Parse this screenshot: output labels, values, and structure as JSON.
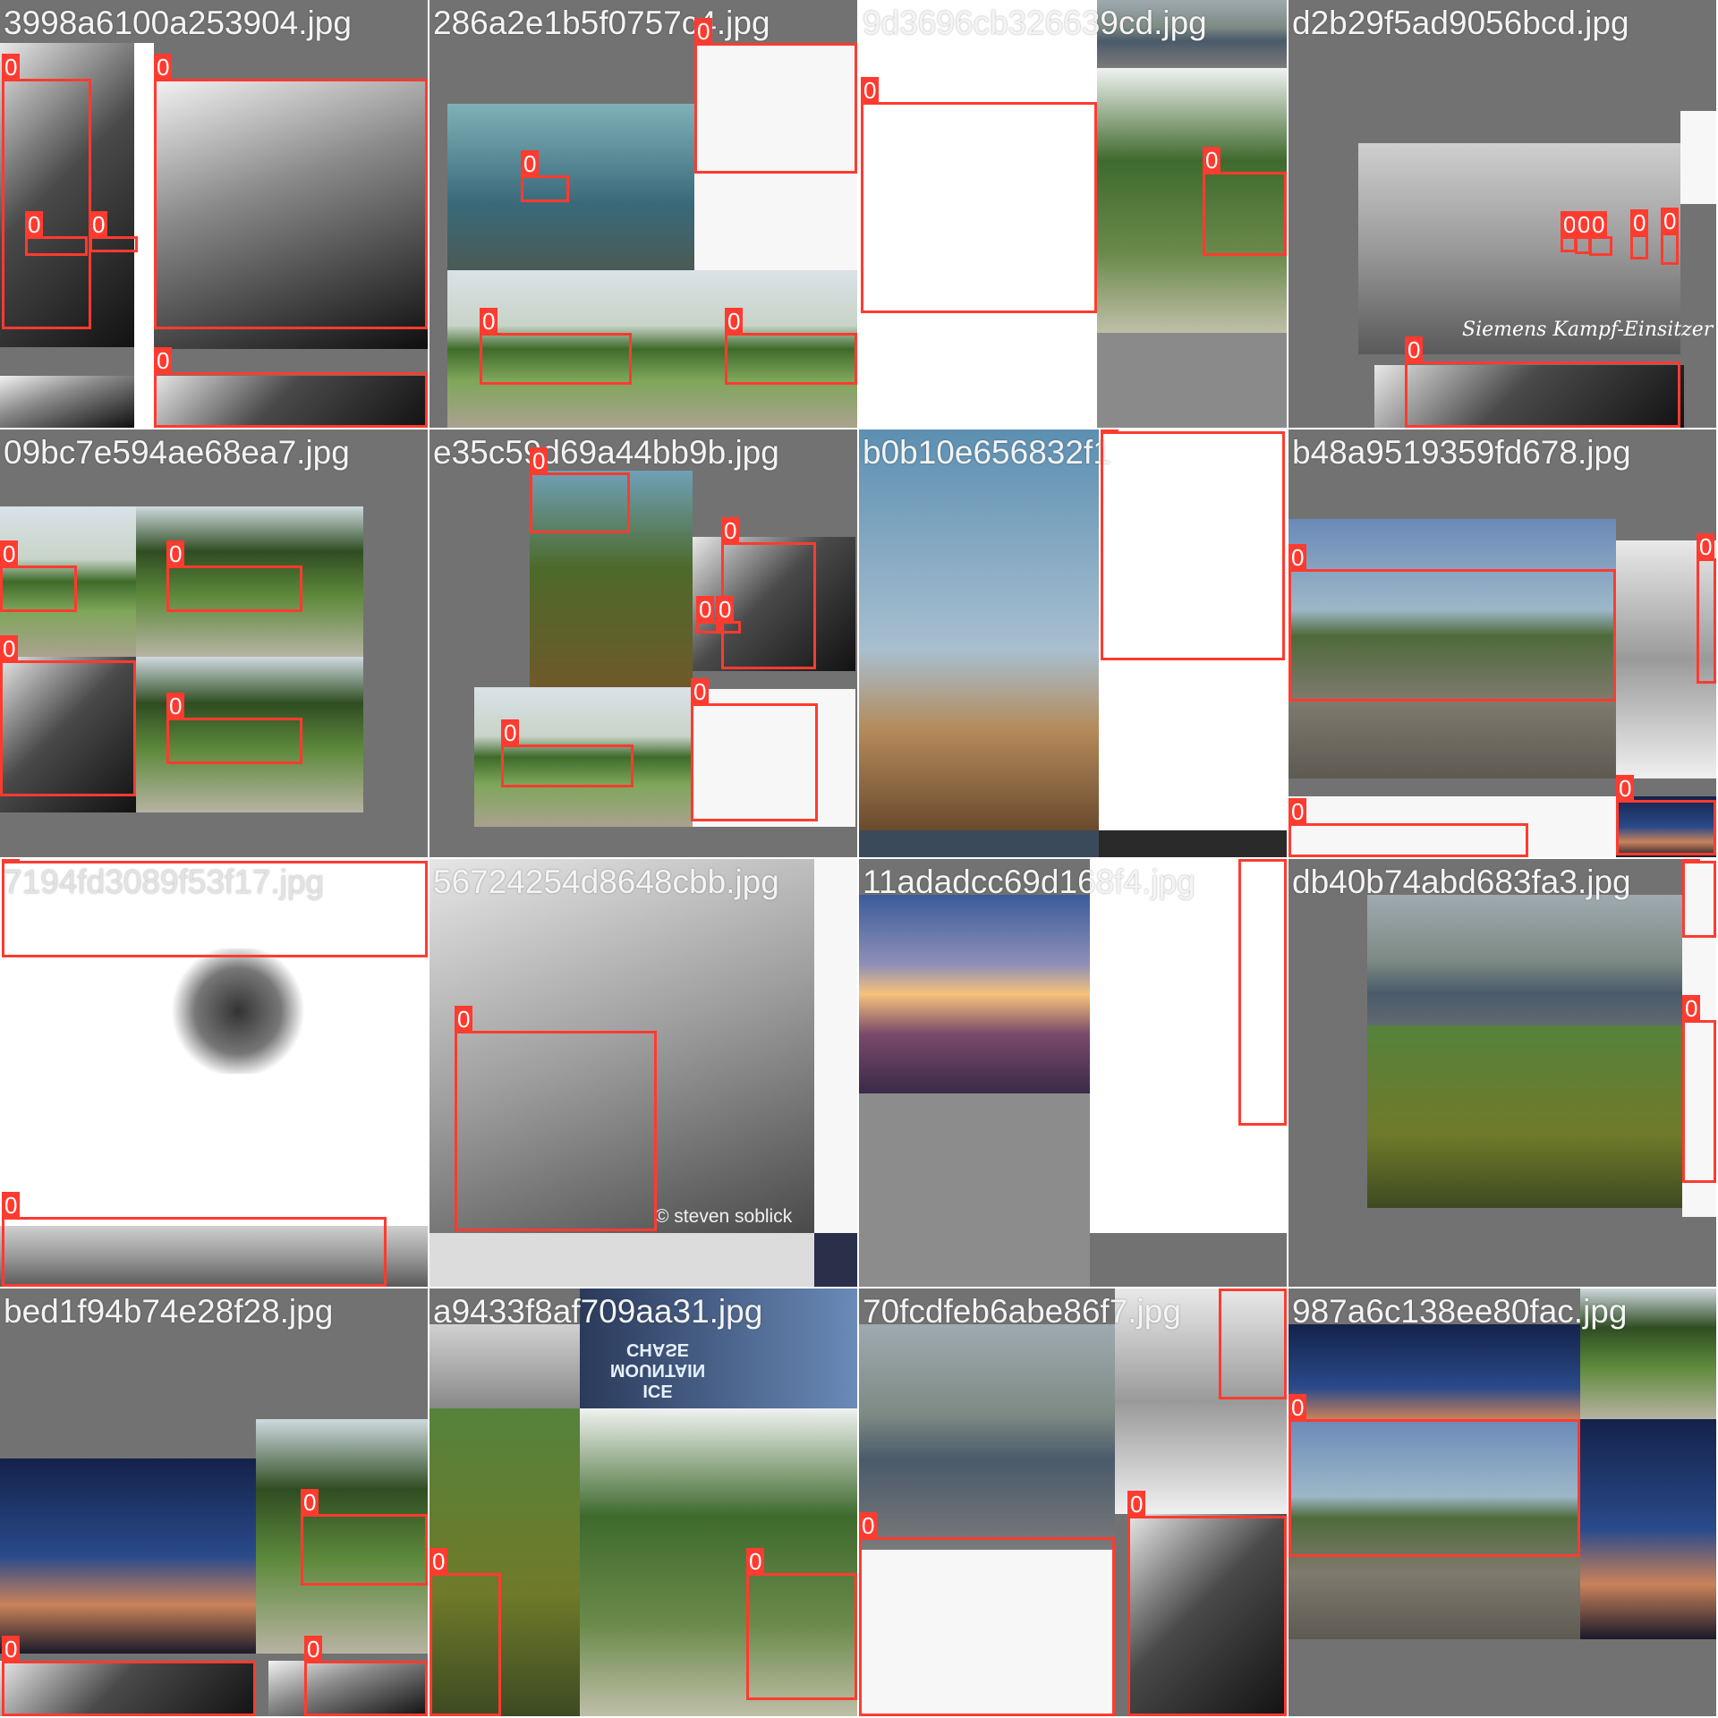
{
  "box_label": "0",
  "tiles": [
    {
      "file": "3998a6100a253904.jpg"
    },
    {
      "file": "286a2e1b5f0757c4.jpg"
    },
    {
      "file": "9d3696cb326639cd.jpg"
    },
    {
      "file": "d2b29f5ad9056bcd.jpg"
    },
    {
      "file": "09bc7e594ae68ea7.jpg"
    },
    {
      "file": "e35c59d69a44bb9b.jpg"
    },
    {
      "file": "b0b10e656832f1"
    },
    {
      "file": "b48a9519359fd678.jpg"
    },
    {
      "file": "7194fd3089f53f17.jpg"
    },
    {
      "file": "56724254d8648cbb.jpg"
    },
    {
      "file": "11adadcc69d168f4.jpg"
    },
    {
      "file": "db40b74abd683fa3.jpg"
    },
    {
      "file": "bed1f94b74e28f28.jpg"
    },
    {
      "file": "a9433f8af709aa31.jpg"
    },
    {
      "file": "70fcdfeb6abe86f7.jpg"
    },
    {
      "file": "987a6c138ee80fac.jpg"
    }
  ],
  "overlay_text": {
    "caption_biplane": "Siemens Kampf-Einsitzer",
    "watermark": "© steven soblick",
    "poster_text": "ICE MOUNTAIN CHASE"
  },
  "colors": {
    "box": "#ff3b30",
    "tile_bg": "#727272",
    "filename_text": "#f4f4f4"
  }
}
